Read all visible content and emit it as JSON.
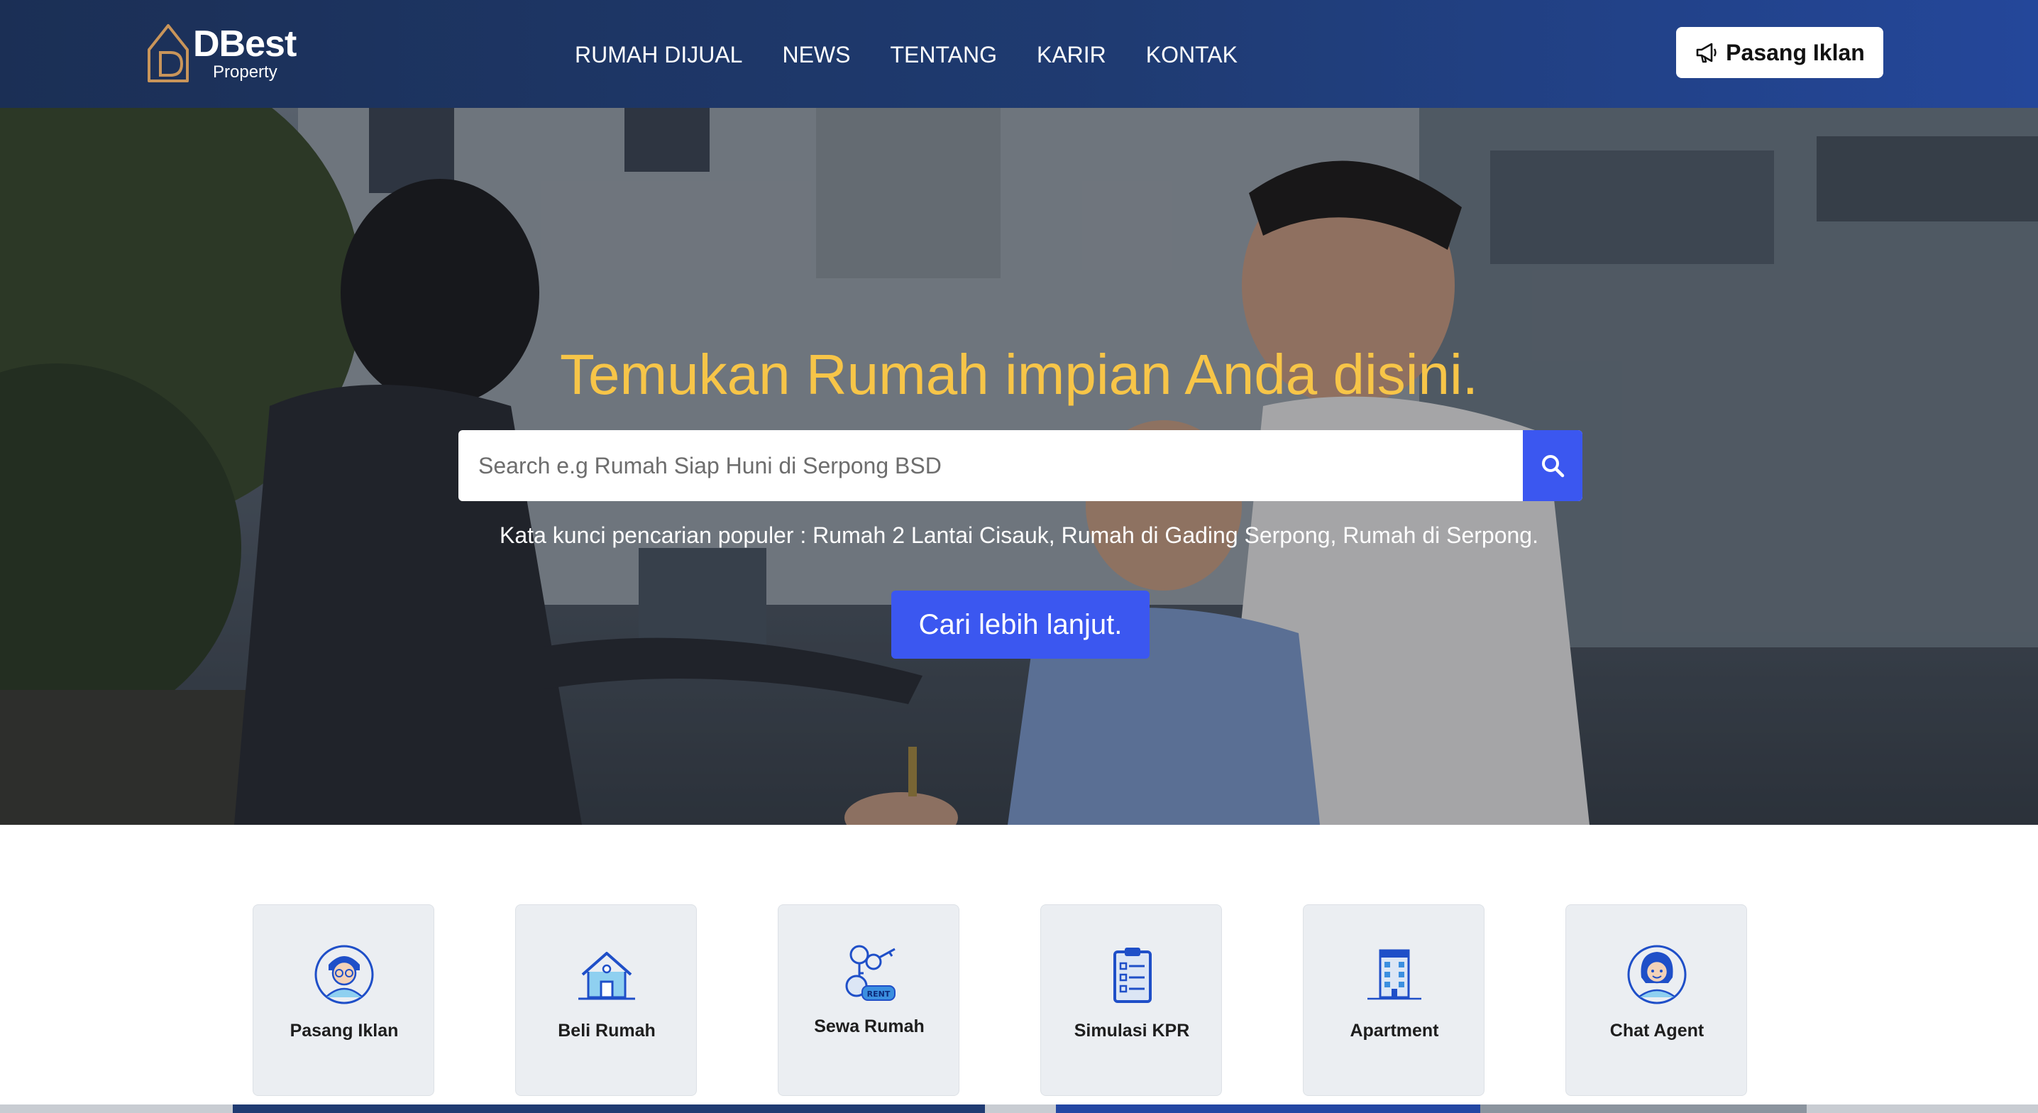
{
  "brand": {
    "name": "DBest",
    "tagline": "Property"
  },
  "nav": {
    "items": [
      {
        "label": "RUMAH DIJUAL"
      },
      {
        "label": "NEWS"
      },
      {
        "label": "TENTANG"
      },
      {
        "label": "KARIR"
      },
      {
        "label": "KONTAK"
      }
    ]
  },
  "header_cta": {
    "label": "Pasang Iklan",
    "icon": "megaphone-icon"
  },
  "hero": {
    "title": "Temukan Rumah impian Anda disini.",
    "search_placeholder": "Search e.g Rumah Siap Huni di Serpong BSD",
    "search_icon": "search-icon",
    "popular_text": "Kata kunci pencarian populer : Rumah 2 Lantai Cisauk, Rumah di Gading Serpong, Rumah di Serpong.",
    "more_button": "Cari lebih lanjut."
  },
  "services": [
    {
      "label": "Pasang Iklan",
      "icon": "agent-avatar-icon"
    },
    {
      "label": "Beli Rumah",
      "icon": "house-icon"
    },
    {
      "label": "Sewa Rumah",
      "icon": "rent-keys-icon"
    },
    {
      "label": "Simulasi KPR",
      "icon": "clipboard-checklist-icon"
    },
    {
      "label": "Apartment",
      "icon": "apartment-building-icon"
    },
    {
      "label": "Chat Agent",
      "icon": "chat-agent-avatar-icon"
    }
  ],
  "colors": {
    "header_start": "#1b2f55",
    "header_end": "#24479a",
    "accent": "#3b57f0",
    "hero_title": "#f7c548",
    "card_bg": "#ebeef2",
    "icon_blue": "#1f4fc8",
    "logo_gold": "#c9955a"
  }
}
